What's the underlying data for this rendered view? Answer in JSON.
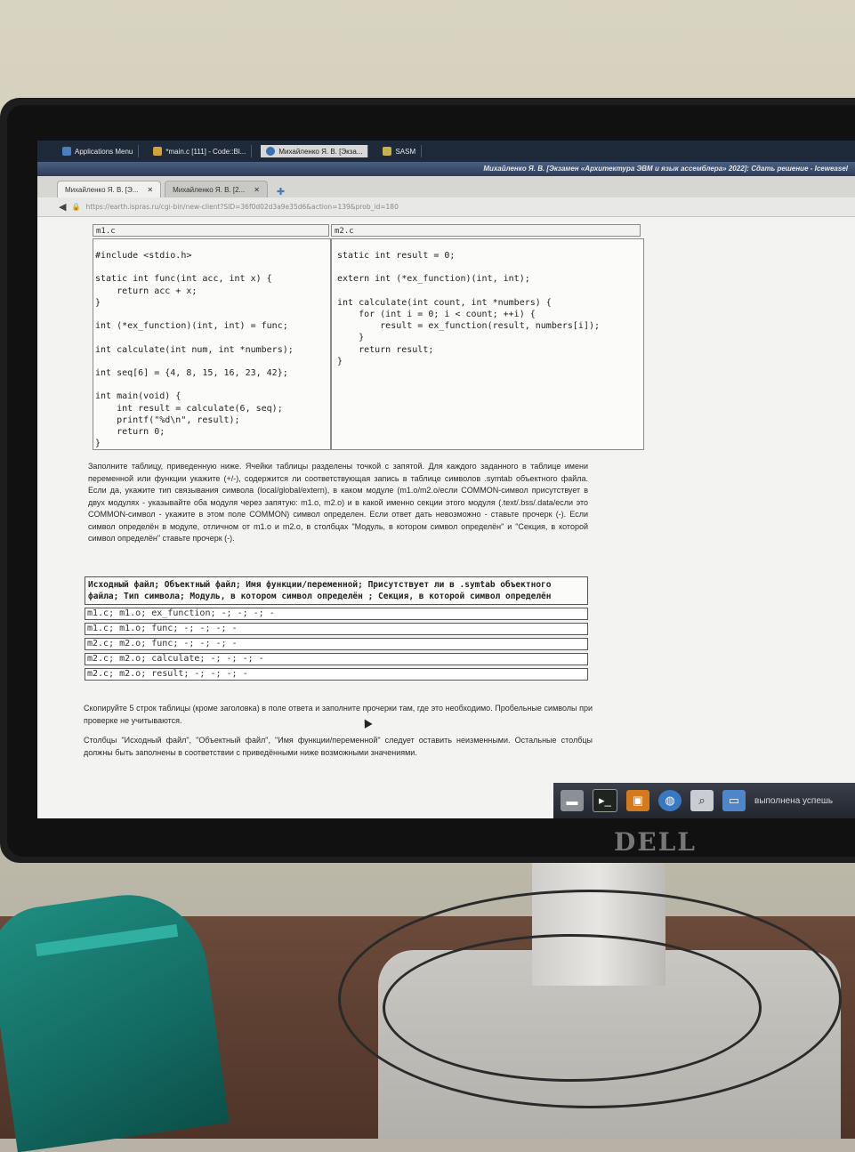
{
  "panel": {
    "items": [
      {
        "label": "Applications Menu",
        "icon": "app-menu-icon"
      },
      {
        "label": "*main.c [111] - Code::Bl...",
        "icon": "codeblocks-icon"
      },
      {
        "label": "Михайленко Я. В. [Экза...",
        "icon": "browser-icon"
      },
      {
        "label": "SASM",
        "icon": "sasm-icon"
      }
    ]
  },
  "window": {
    "title": "Михайленко Я. В. [Экзамен «Архитектура ЭВМ и язык ассемблера» 2022]: Сдать решение - Iceweasel"
  },
  "tabs": [
    {
      "label": "Михайленко Я. В. [Э..."
    },
    {
      "label": "Михайленко Я. В. [2..."
    }
  ],
  "url": "https://earth.ispras.ru/cgi-bin/new-client?SID=36f0d02d3a9e35d6&action=139&prob_id=180",
  "files": {
    "m1": {
      "name": "m1.c",
      "code": "#include <stdio.h>\n\nstatic int func(int acc, int x) {\n    return acc + x;\n}\n\nint (*ex_function)(int, int) = func;\n\nint calculate(int num, int *numbers);\n\nint seq[6] = {4, 8, 15, 16, 23, 42};\n\nint main(void) {\n    int result = calculate(6, seq);\n    printf(\"%d\\n\", result);\n    return 0;\n}"
    },
    "m2": {
      "name": "m2.c",
      "code": "static int result = 0;\n\nextern int (*ex_function)(int, int);\n\nint calculate(int count, int *numbers) {\n    for (int i = 0; i < count; ++i) {\n        result = ex_function(result, numbers[i]);\n    }\n    return result;\n}"
    }
  },
  "instructions": "Заполните таблицу, приведенную ниже. Ячейки таблицы разделены точкой с запятой. Для каждого заданного в таблице имени переменной или функции укажите (+/-), содержится ли соответствующая запись в таблице символов .symtab объектного файла. Если да, укажите тип связывания символа (local/global/extern), в каком модуле (m1.o/m2.o/если COMMON-символ присутствует в двух модулях - указывайте оба модуля через запятую: m1.o, m2.o) и в какой именно секции этого модуля (.text/.bss/.data/если это COMMON-символ - укажите в этом поле COMMON) символ определен. Если ответ дать невозможно - ставьте прочерк (-). Если символ определён в модуле, отличном от m1.o и m2.o, в столбцах \"Модуль, в котором символ определён\" и \"Секция, в которой символ определён\" ставьте прочерк (-).",
  "table": {
    "header": "Исходный файл; Объектный файл; Имя функции/переменной; Присутствует ли в .symtab объектного файла; Тип символа; Модуль, в котором символ определён ; Секция, в которой символ определён",
    "rows": [
      "m1.c; m1.o; ex_function; -; -; -; -",
      "m1.c; m1.o; func; -; -; -; -",
      "m2.c; m2.o; func; -; -; -; -",
      "m2.c; m2.o; calculate; -; -; -; -",
      "m2.c; m2.o; result; -; -; -; -"
    ]
  },
  "note1": "Скопируйте 5 строк таблицы (кроме заголовка) в поле ответа и заполните прочерки там, где это необходимо. Пробельные символы при проверке не учитываются.",
  "note2": "Столбцы \"Исходный файл\", \"Объектный файл\", \"Имя функции/переменной\" следует оставить неизменными. Остальные столбцы должны быть заполнены в соответствии с приведёнными ниже возможными значениями.",
  "taskbar": {
    "icons": [
      "drive-icon",
      "terminal-icon",
      "archive-icon",
      "globe-icon",
      "search-icon",
      "folder-icon"
    ],
    "status": "выполнена успешь"
  },
  "monitor_brand": "DELL"
}
